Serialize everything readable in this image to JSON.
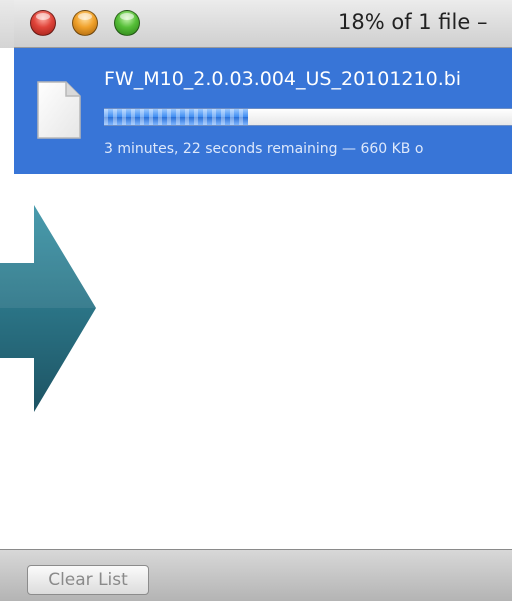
{
  "window": {
    "title": "18% of 1 file –"
  },
  "download": {
    "filename": "FW_M10_2.0.03.004_US_20101210.bi",
    "progress_percent": 18,
    "status": "3 minutes, 22 seconds remaining — 660 KB o",
    "icon": "document-icon"
  },
  "toolbar": {
    "clear_label": "Clear List"
  },
  "colors": {
    "selection": "#3875d7",
    "progress": "#3d8cf2",
    "arrow": "#2f7f90"
  }
}
